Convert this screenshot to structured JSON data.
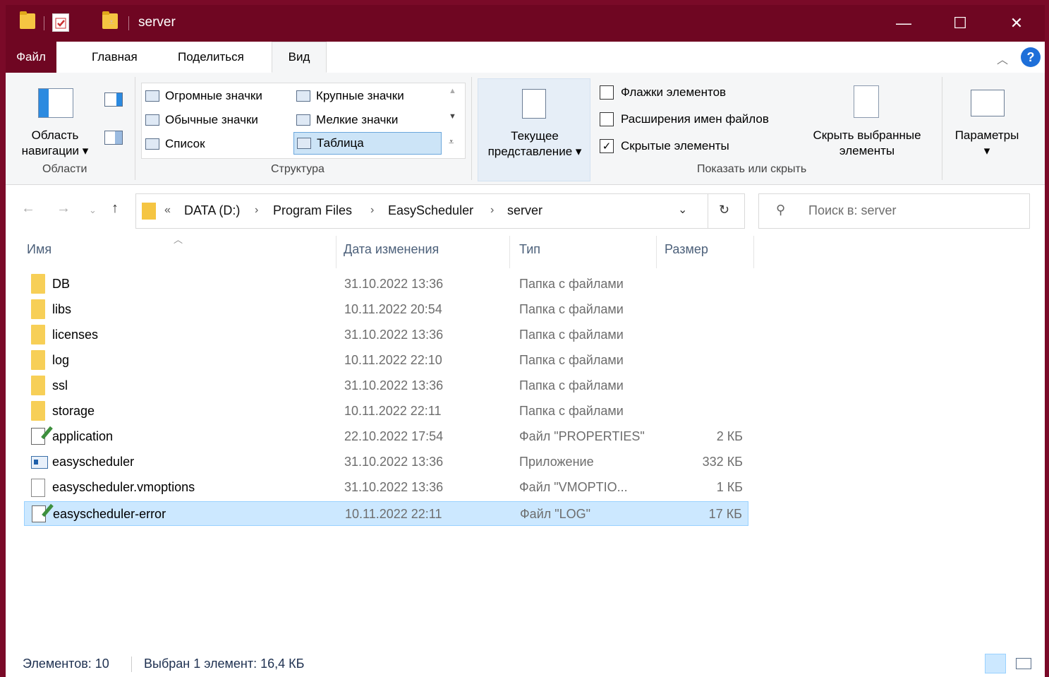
{
  "window": {
    "title": "server",
    "controls": {
      "minimize": "—",
      "maximize": "☐",
      "close": "✕"
    }
  },
  "tabs": [
    {
      "label": "Файл"
    },
    {
      "label": "Главная"
    },
    {
      "label": "Поделиться"
    },
    {
      "label": "Вид"
    }
  ],
  "ribbon": {
    "areas": {
      "group_label": "Области",
      "nav_pane_label_line1": "Область",
      "nav_pane_label_line2": "навигации"
    },
    "structure": {
      "group_label": "Структура",
      "layouts": [
        "Огромные значки",
        "Крупные значки",
        "Обычные значки",
        "Мелкие значки",
        "Список",
        "Таблица"
      ],
      "selected": "Таблица"
    },
    "current_view": {
      "label_line1": "Текущее",
      "label_line2": "представление"
    },
    "show_hide": {
      "group_label": "Показать или скрыть",
      "checkboxes": [
        {
          "label": "Флажки элементов",
          "checked": false
        },
        {
          "label": "Расширения имен файлов",
          "checked": false
        },
        {
          "label": "Скрытые элементы",
          "checked": true
        }
      ],
      "hide_selected_line1": "Скрыть выбранные",
      "hide_selected_line2": "элементы"
    },
    "options": {
      "label": "Параметры"
    }
  },
  "address": {
    "overflow": "«",
    "crumbs": [
      "DATA (D:)",
      "Program Files",
      "EasyScheduler",
      "server"
    ]
  },
  "search": {
    "placeholder": "Поиск в: server"
  },
  "columns": {
    "name": "Имя",
    "date": "Дата изменения",
    "type": "Тип",
    "size": "Размер"
  },
  "files": [
    {
      "name": "DB",
      "date": "31.10.2022 13:36",
      "type": "Папка с файлами",
      "size": "",
      "icon": "folder-icon"
    },
    {
      "name": "libs",
      "date": "10.11.2022 20:54",
      "type": "Папка с файлами",
      "size": "",
      "icon": "folder-icon"
    },
    {
      "name": "licenses",
      "date": "31.10.2022 13:36",
      "type": "Папка с файлами",
      "size": "",
      "icon": "folder-icon"
    },
    {
      "name": "log",
      "date": "10.11.2022 22:10",
      "type": "Папка с файлами",
      "size": "",
      "icon": "folder-icon"
    },
    {
      "name": "ssl",
      "date": "31.10.2022 13:36",
      "type": "Папка с файлами",
      "size": "",
      "icon": "folder-icon"
    },
    {
      "name": "storage",
      "date": "10.11.2022 22:11",
      "type": "Папка с файлами",
      "size": "",
      "icon": "folder-icon"
    },
    {
      "name": "application",
      "date": "22.10.2022 17:54",
      "type": "Файл \"PROPERTIES\"",
      "size": "2 КБ",
      "icon": "edit-file-icon"
    },
    {
      "name": "easyscheduler",
      "date": "31.10.2022 13:36",
      "type": "Приложение",
      "size": "332 КБ",
      "icon": "app-icon"
    },
    {
      "name": "easyscheduler.vmoptions",
      "date": "31.10.2022 13:36",
      "type": "Файл \"VMOPTIO...",
      "size": "1 КБ",
      "icon": "text-file-icon"
    },
    {
      "name": "easyscheduler-error",
      "date": "10.11.2022 22:11",
      "type": "Файл \"LOG\"",
      "size": "17 КБ",
      "icon": "edit-file-icon",
      "selected": true
    }
  ],
  "status": {
    "count": "Элементов: 10",
    "selection": "Выбран 1 элемент: 16,4 КБ"
  }
}
